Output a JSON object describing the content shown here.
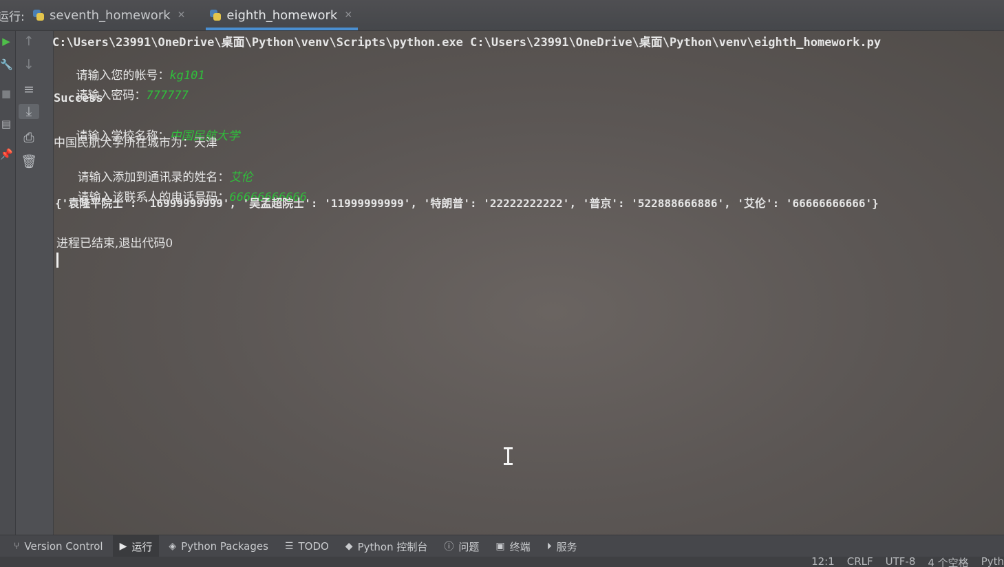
{
  "tabbar": {
    "run_label": "运行:",
    "tabs": [
      {
        "label": "seventh_homework",
        "active": false
      },
      {
        "label": "eighth_homework",
        "active": true
      }
    ]
  },
  "console": {
    "command": "C:\\Users\\23991\\OneDrive\\桌面\\Python\\venv\\Scripts\\python.exe C:\\Users\\23991\\OneDrive\\桌面\\Python\\venv\\eighth_homework.py",
    "lines": [
      {
        "prompt": "请输入您的帐号：",
        "input": "kg101"
      },
      {
        "prompt": "请输入密码：",
        "input": "777777"
      },
      {
        "text": "Success"
      },
      {
        "prompt": "请输入学校名称：",
        "input": "中国民航大学"
      },
      {
        "text": "中国民航大学所在城市为：天津"
      },
      {
        "prompt": "请输入添加到通讯录的姓名：",
        "input": "艾伦"
      },
      {
        "prompt": "请输入该联系人的电话号码：",
        "input": "66666666666"
      },
      {
        "text": "{'袁隆平院士': '16999999999', '吴孟超院士': '11999999999', '特朗普': '22222222222', '普京': '522888666886', '艾伦': '66666666666'}"
      },
      {
        "text": "进程已结束,退出代码0"
      }
    ]
  },
  "toolbar": {
    "items": [
      {
        "label": "Version Control",
        "icon": "branch-icon"
      },
      {
        "label": "运行",
        "icon": "run-icon",
        "active": true
      },
      {
        "label": "Python Packages",
        "icon": "packages-icon"
      },
      {
        "label": "TODO",
        "icon": "list-icon"
      },
      {
        "label": "Python 控制台",
        "icon": "python-console-icon"
      },
      {
        "label": "问题",
        "icon": "problems-icon"
      },
      {
        "label": "终端",
        "icon": "terminal-icon"
      },
      {
        "label": "服务",
        "icon": "services-icon"
      }
    ]
  },
  "statusbar": {
    "position": "12:1",
    "line_ending": "CRLF",
    "encoding": "UTF-8",
    "indent": "4 个空格",
    "interpreter": "Pyth"
  },
  "colors": {
    "user_input": "#2fbf3b",
    "tab_underline": "#4a8fd1"
  }
}
